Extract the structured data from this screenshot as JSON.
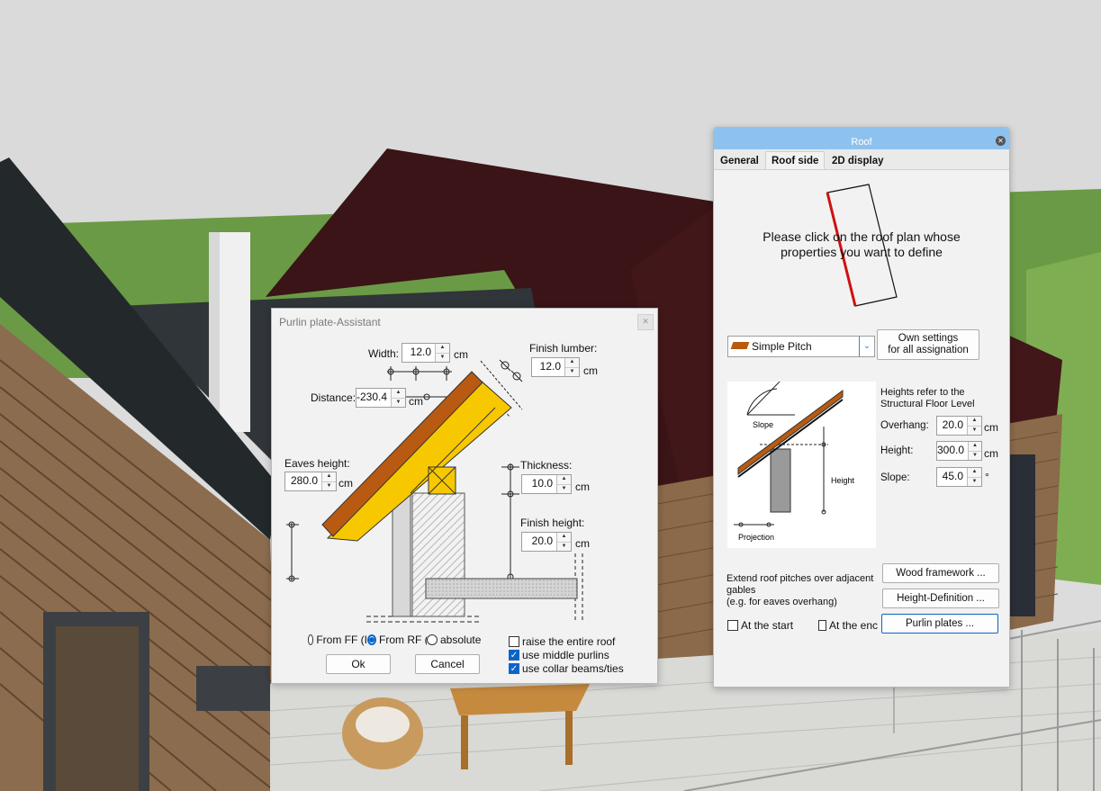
{
  "purlin_dialog": {
    "title": "Purlin plate-Assistant",
    "close_icon": "close-icon",
    "width": {
      "label": "Width:",
      "value": "12.0",
      "unit": "cm"
    },
    "finish_lumber": {
      "label": "Finish lumber:",
      "value": "12.0",
      "unit": "cm"
    },
    "distance": {
      "label": "Distance:",
      "value": "-230.4",
      "unit": "cm"
    },
    "eaves_height": {
      "label": "Eaves height:",
      "value": "280.0",
      "unit": "cm"
    },
    "thickness": {
      "label": "Thickness:",
      "value": "10.0",
      "unit": "cm"
    },
    "finish_height": {
      "label": "Finish height:",
      "value": "20.0",
      "unit": "cm"
    },
    "reference": {
      "options": [
        "From FF (I",
        "From RF (I",
        "absolute"
      ],
      "selected": "From RF (I"
    },
    "checkboxes": [
      {
        "label": "raise the entire roof",
        "checked": false
      },
      {
        "label": "use middle purlins",
        "checked": true
      },
      {
        "label": "use collar beams/ties",
        "checked": true
      }
    ],
    "ok_label": "Ok",
    "cancel_label": "Cancel"
  },
  "roof_dialog": {
    "title": "Roof",
    "tabs": [
      {
        "label": "General",
        "active": false
      },
      {
        "label": "Roof side",
        "active": true
      },
      {
        "label": "2D display",
        "active": false
      }
    ],
    "instruction_line1": "Please click on the roof plan whose",
    "instruction_line2": "properties you want to define",
    "roof_type": "Simple Pitch",
    "own_settings_line1": "Own settings",
    "own_settings_line2": "for all assignation",
    "heights_note_line1": "Heights refer to the",
    "heights_note_line2": "Structural Floor Level",
    "overhang": {
      "label": "Overhang:",
      "value": "20.0",
      "unit": "cm"
    },
    "height": {
      "label": "Height:",
      "value": "300.0",
      "unit": "cm"
    },
    "slope": {
      "label": "Slope:",
      "value": "45.0",
      "unit": "°"
    },
    "diagram_labels": {
      "slope": "Slope",
      "height": "Height",
      "projection": "Projection"
    },
    "extend_note_line1": "Extend roof pitches over adjacent",
    "extend_note_line2": "gables",
    "extend_note_line3": "(e.g. for eaves overhang)",
    "at_start": {
      "label": "At the start",
      "checked": false
    },
    "at_end": {
      "label": "At the enc",
      "checked": false
    },
    "buttons": {
      "wood_framework": "Wood framework ...",
      "height_definition": "Height-Definition ...",
      "purlin_plates": "Purlin plates ..."
    }
  },
  "colors": {
    "roof_title_bar": "#8ec2ee",
    "rafter_brown": "#b85a12",
    "purlin_yellow": "#f7c800",
    "selected_edge_red": "#d01010",
    "accent_blue": "#0a64c8"
  }
}
